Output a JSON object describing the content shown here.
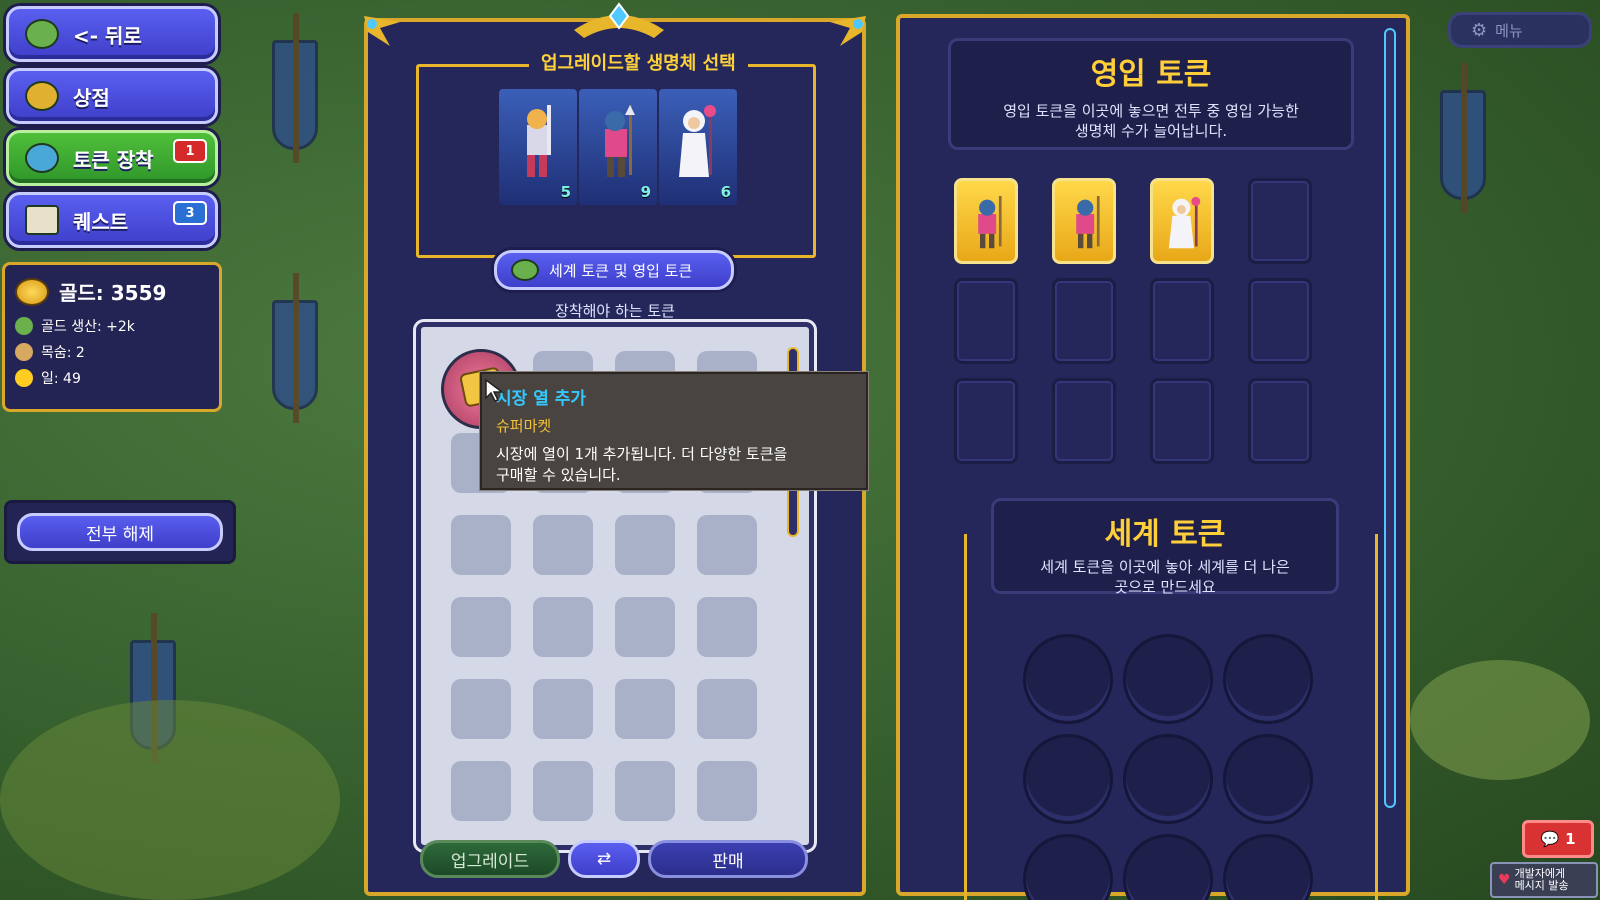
{
  "nav": {
    "back_label": "<- 뒤로",
    "shop_label": "상점",
    "token_equip_label": "토큰 장착",
    "token_equip_badge": "1",
    "quest_label": "퀘스트",
    "quest_badge": "3"
  },
  "stats": {
    "gold": "골드: 3559",
    "gold_production": "골드 생산: +2k",
    "lives": "목숨: 2",
    "day": "일: 49"
  },
  "unequip_all_label": "전부 해제",
  "upgrade_panel": {
    "title": "업그레이드할 생명체 선택",
    "units": [
      {
        "name": "knight",
        "count": "5"
      },
      {
        "name": "spearman",
        "count": "9"
      },
      {
        "name": "priest",
        "count": "6"
      }
    ],
    "tokens_button": "세계 토큰 및 영입 토큰",
    "need_label": "장착해야 하는 토큰"
  },
  "tooltip": {
    "title": "시장 열 추가",
    "subtitle": "슈퍼마켓",
    "description_line1": "시장에 열이 1개 추가됩니다. 더 다양한 토큰을",
    "description_line2": "구매할 수 있습니다."
  },
  "bottom_buttons": {
    "upgrade": "업그레이드",
    "sell": "판매"
  },
  "recruit_tokens": {
    "title": "영입 토큰",
    "desc_line1": "영입 토큰을 이곳에 놓으면 전투 중 영입 가능한",
    "desc_line2": "생명체 수가 늘어납니다.",
    "slots": [
      "spearman",
      "spearman",
      "priest",
      "",
      "",
      "",
      "",
      "",
      "",
      "",
      "",
      ""
    ]
  },
  "world_tokens": {
    "title": "세계 토큰",
    "desc_line1": "세계 토큰을 이곳에 놓아 세계를 더 나은",
    "desc_line2": "곳으로 만드세요"
  },
  "menu_label": "메뉴",
  "chat_count": "1",
  "dev_message_line1": "개발자에게",
  "dev_message_line2": "메시지 발송",
  "colors": {
    "panel": "#25275a",
    "gold_border": "#d9a72a",
    "title_yellow": "#ffcf3a",
    "tooltip_title": "#33c9ff",
    "tooltip_sub": "#f0c038"
  }
}
